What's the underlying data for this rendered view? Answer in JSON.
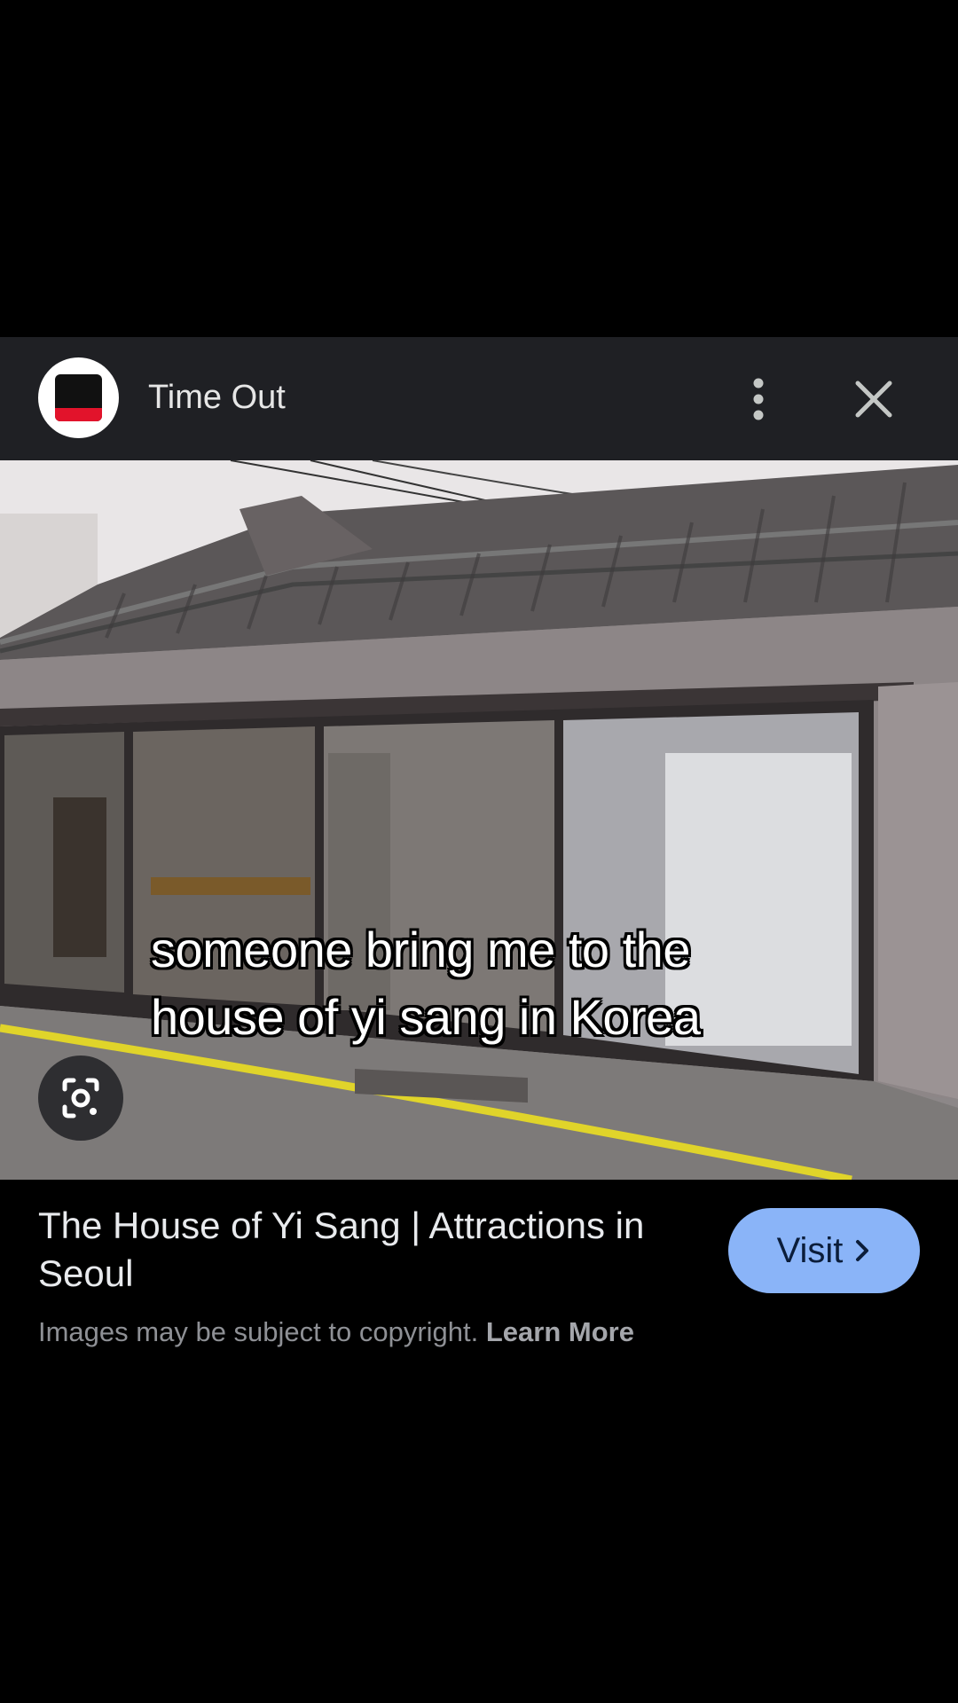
{
  "header": {
    "site_name": "Time Out",
    "more_icon": "more-vert-icon",
    "close_icon": "close-icon"
  },
  "photo": {
    "caption_line1": "someone bring me to the",
    "caption_line2": "house of yi sang in Korea",
    "lens_icon": "image-search-icon"
  },
  "result": {
    "title": "The House of Yi Sang | Attractions in Seoul",
    "visit_label": "Visit",
    "visit_icon": "chevron-right-icon",
    "copyright_text": "Images may be subject to copyright.",
    "learn_more": "Learn More"
  },
  "colors": {
    "card_bg": "#1f2024",
    "visit_button": "#8ab4f8",
    "brand_red": "#e2132b"
  }
}
